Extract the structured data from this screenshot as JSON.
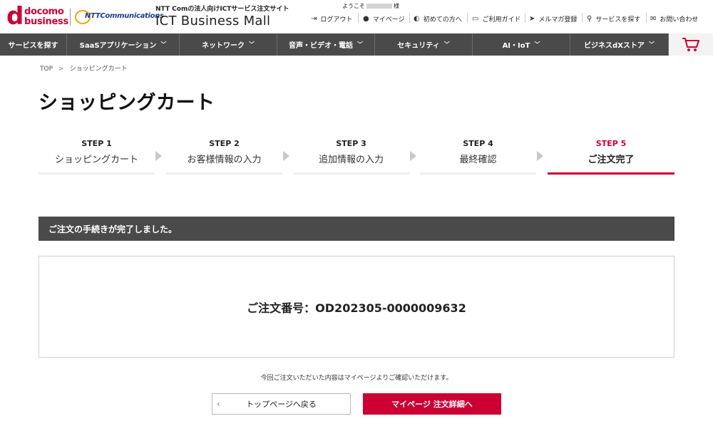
{
  "header": {
    "logo_docomo_d": "d",
    "logo_docomo_line1": "docomo",
    "logo_docomo_line2": "business",
    "logo_ntt": "NTTCommunications",
    "site_subtitle": "NTT Comの法人向けICTサービス注文サイト",
    "site_title": "ICT Business Mall",
    "welcome_prefix": "ようこそ",
    "welcome_suffix": "様",
    "links": [
      {
        "label": "ログアウト",
        "icon": "logout-icon"
      },
      {
        "label": "マイページ",
        "icon": "user-icon"
      },
      {
        "label": "初めての方へ",
        "icon": "beginner-icon"
      },
      {
        "label": "ご利用ガイド",
        "icon": "book-icon"
      },
      {
        "label": "メルマガ登録",
        "icon": "send-icon"
      },
      {
        "label": "サービスを探す",
        "icon": "search-icon"
      },
      {
        "label": "お問い合わせ",
        "icon": "mail-icon"
      }
    ]
  },
  "nav": {
    "items": [
      {
        "label": "サービスを探す"
      },
      {
        "label": "SaaSアプリケーション"
      },
      {
        "label": "ネットワーク"
      },
      {
        "label": "音声・ビデオ・電話"
      },
      {
        "label": "セキュリティ"
      },
      {
        "label": "AI・IoT"
      },
      {
        "label": "ビジネスdXストア"
      }
    ],
    "cart_icon": "cart-icon"
  },
  "breadcrumb": {
    "home": "TOP",
    "current": "ショッピングカート"
  },
  "page_title": "ショッピングカート",
  "steps": [
    {
      "num": "STEP 1",
      "label": "ショッピングカート"
    },
    {
      "num": "STEP 2",
      "label": "お客様情報の入力"
    },
    {
      "num": "STEP 3",
      "label": "追加情報の入力"
    },
    {
      "num": "STEP 4",
      "label": "最終確認"
    },
    {
      "num": "STEP 5",
      "label": "ご注文完了"
    }
  ],
  "active_step": 5,
  "complete_message": "ご注文の手続きが完了しました。",
  "order": {
    "label": "ご注文番号：",
    "number": "OD202305-0000009632"
  },
  "note": "今回ご注文いただいた内容はマイページよりご確認いただけます。",
  "buttons": {
    "back": "トップページへ戻る",
    "mypage": "マイページ 注文詳細へ"
  },
  "colors": {
    "accent": "#cc0033",
    "nav_bg": "#4a4a4a"
  }
}
